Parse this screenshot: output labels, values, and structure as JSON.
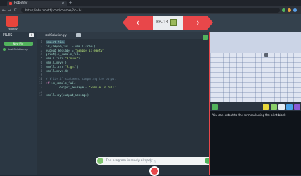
{
  "browser": {
    "tab_title": "Robotify",
    "url": "https://edu.robotify.com/console/?ic=34",
    "nav_back": "←",
    "nav_forward": "→",
    "reload": "C",
    "new_tab": "+",
    "close": "×"
  },
  "app": {
    "logo_label": "robotify",
    "level": "RP-13.5",
    "prev": "‹",
    "next": "›"
  },
  "sidebar": {
    "title": "FILES",
    "add": "+",
    "new_file_label": "New File",
    "files": [
      "taskSolution.py"
    ]
  },
  "editor": {
    "tab_label": "taskSolution.py",
    "lines": [
      {
        "n": "1",
        "html": "<span class='hl'>import time</span>"
      },
      {
        "n": "2",
        "html": "is_sample_full = smell.scan()"
      },
      {
        "n": "3",
        "html": "output_message = <span class='str'>\"Sample is empty\"</span>"
      },
      {
        "n": "4",
        "html": "print(is_sample_full)"
      },
      {
        "n": "5",
        "html": "smell.turn(<span class='str'>\"Around\"</span>)"
      },
      {
        "n": "6",
        "html": "smell.move()"
      },
      {
        "n": "7",
        "html": "smell.turn(<span class='str'>\"Right\"</span>)"
      },
      {
        "n": "8",
        "html": "smell.move(4)"
      },
      {
        "n": "9",
        "html": ""
      },
      {
        "n": "10",
        "html": "<span class='cm'># Write if statement comparing the output</span>"
      },
      {
        "n": "11",
        "html": "<span class='kw'>if</span> is_sample_full:"
      },
      {
        "n": "12",
        "html": "        output_message = <span class='str'>\"Sample is full\"</span>"
      },
      {
        "n": "13",
        "html": ""
      },
      {
        "n": "14",
        "html": "smell.say(output_message)"
      }
    ]
  },
  "status": {
    "message": "The program is ready already",
    "pager": "1 . 1 . 1"
  },
  "console": {
    "text": "You can output to the terminal using the print block"
  },
  "colors": {
    "accent": "#e8474a",
    "green": "#52b35c"
  }
}
